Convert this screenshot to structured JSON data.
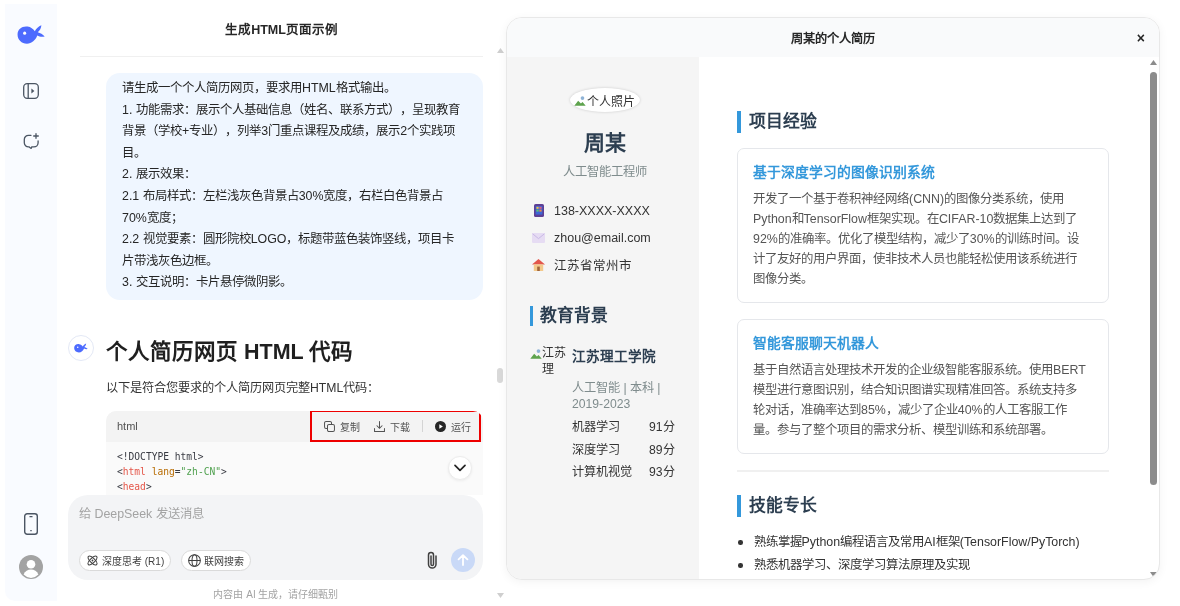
{
  "chat": {
    "title": "生成HTML页面示例",
    "user_message": [
      "请生成一个个人简历网页，要求用HTML格式输出。",
      "1. 功能需求：展示个人基础信息（姓名、联系方式），呈现教育背景（学校+专业），列举3门重点课程及成绩，展示2个实践项目。",
      "2. 展示效果：",
      "2.1 布局样式：左栏浅灰色背景占30%宽度，右栏白色背景占70%宽度；",
      "2.2 视觉要素：圆形院校LOGO，标题带蓝色装饰竖线，项目卡片带浅灰色边框。",
      "3. 交互说明：卡片悬停微阴影。"
    ],
    "answer": {
      "heading": "个人简历网页 HTML 代码",
      "intro": "以下是符合您要求的个人简历网页完整HTML代码：",
      "code_block": {
        "language": "html",
        "actions_highlighted": true,
        "actions": [
          {
            "kind": "copy",
            "label": "复制"
          },
          {
            "kind": "download",
            "label": "下载"
          },
          {
            "kind": "run",
            "label": "运行"
          }
        ],
        "lines": [
          [
            {
              "kind": "plain",
              "text": "<!DOCTYPE html>"
            }
          ],
          [
            {
              "kind": "punct",
              "text": "<"
            },
            {
              "kind": "tag",
              "text": "html"
            },
            {
              "kind": "attr",
              "text": " lang"
            },
            {
              "kind": "punct",
              "text": "="
            },
            {
              "kind": "string",
              "text": "\"zh-CN\""
            },
            {
              "kind": "punct",
              "text": ">"
            }
          ],
          [
            {
              "kind": "punct",
              "text": "<"
            },
            {
              "kind": "tag",
              "text": "head"
            },
            {
              "kind": "punct",
              "text": ">"
            }
          ]
        ]
      }
    },
    "composer": {
      "placeholder": "给 DeepSeek 发送消息",
      "toggles": [
        {
          "kind": "deep-think",
          "label": "深度思考 (R1)",
          "selected": false
        },
        {
          "kind": "web-search",
          "label": "联网搜索",
          "selected": false
        }
      ],
      "send_button": {
        "disabled": true
      }
    },
    "disclaimer": "内容由 AI 生成，请仔细甄别"
  },
  "preview": {
    "title": "周某的个人简历",
    "close_label": "×",
    "resume": {
      "photo_alt": "个人照片",
      "name": "周某",
      "job_title": "人工智能工程师",
      "contacts": [
        {
          "kind": "phone",
          "text": "138-XXXX-XXXX"
        },
        {
          "kind": "email",
          "text": "zhou@email.com"
        },
        {
          "kind": "location",
          "text": "江苏省常州市"
        }
      ],
      "education": {
        "heading": "教育背景",
        "logo_alt": "江苏理",
        "school": "江苏理工学院",
        "details": "人工智能 | 本科 | 2019-2023",
        "courses": [
          {
            "name": "机器学习",
            "score": "91分"
          },
          {
            "name": "深度学习",
            "score": "89分"
          },
          {
            "name": "计算机视觉",
            "score": "93分"
          }
        ]
      },
      "projects": {
        "heading": "项目经验",
        "items": [
          {
            "title": "基于深度学习的图像识别系统",
            "description": "开发了一个基于卷积神经网络(CNN)的图像分类系统，使用Python和TensorFlow框架实现。在CIFAR-10数据集上达到了92%的准确率。优化了模型结构，减少了30%的训练时间。设计了友好的用户界面，使非技术人员也能轻松使用该系统进行图像分类。"
          },
          {
            "title": "智能客服聊天机器人",
            "description": "基于自然语言处理技术开发的企业级智能客服系统。使用BERT模型进行意图识别，结合知识图谱实现精准回答。系统支持多轮对话，准确率达到85%，减少了企业40%的人工客服工作量。参与了整个项目的需求分析、模型训练和系统部署。"
          }
        ]
      },
      "skills": {
        "heading": "技能专长",
        "items": [
          "熟练掌握Python编程语言及常用AI框架(TensorFlow/PyTorch)",
          "熟悉机器学习、深度学习算法原理及实现"
        ]
      }
    }
  }
}
